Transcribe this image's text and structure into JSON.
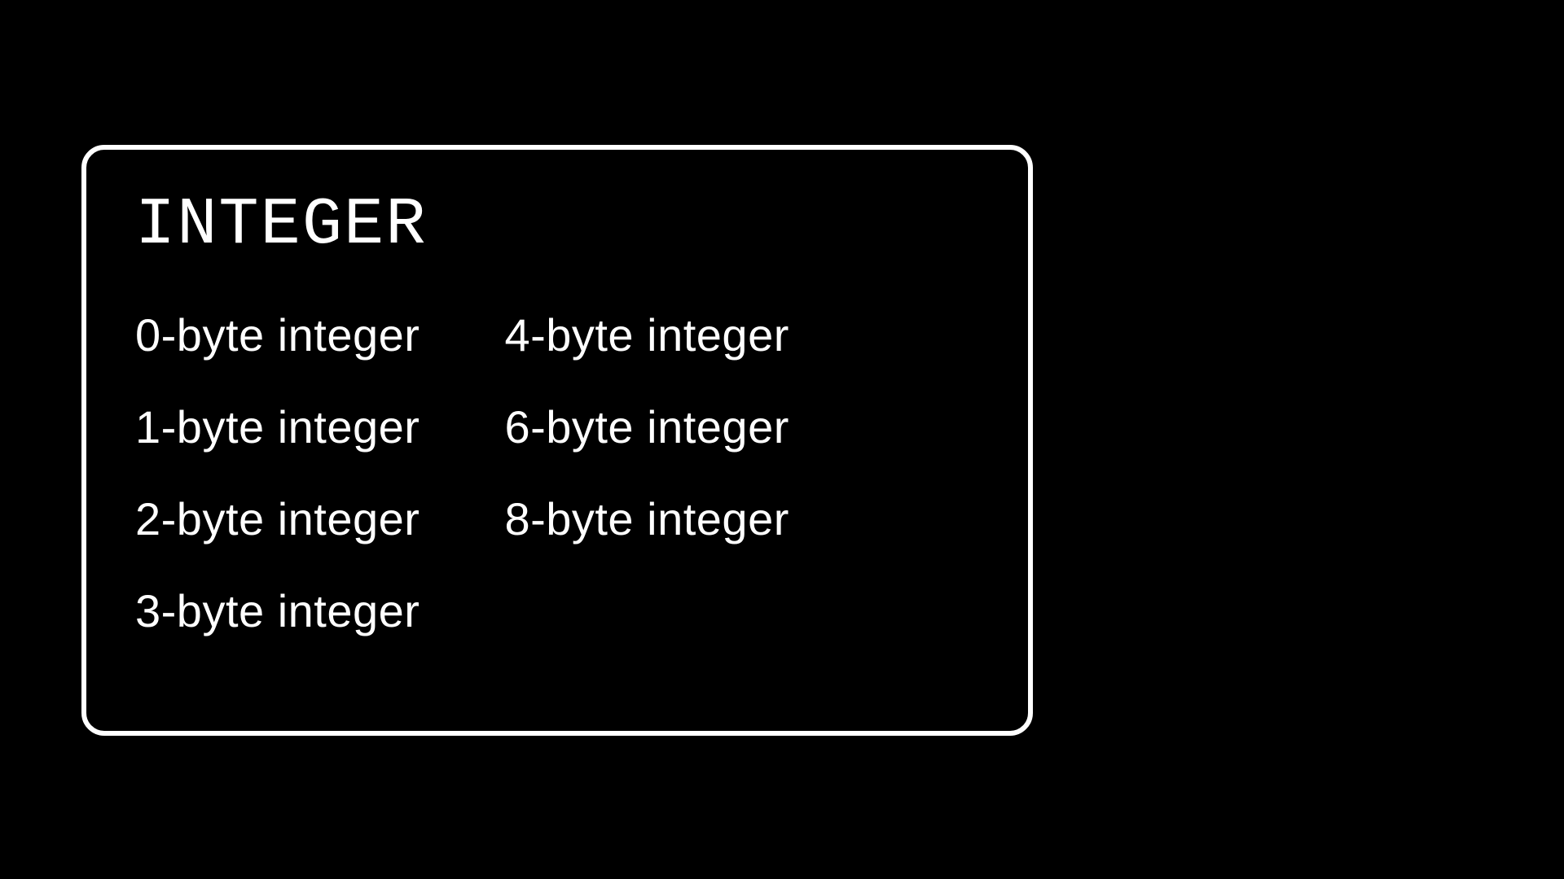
{
  "box": {
    "title": "INTEGER",
    "columns": [
      [
        "0-byte integer",
        "1-byte integer",
        "2-byte integer",
        "3-byte integer"
      ],
      [
        "4-byte integer",
        "6-byte integer",
        "8-byte integer"
      ]
    ]
  }
}
